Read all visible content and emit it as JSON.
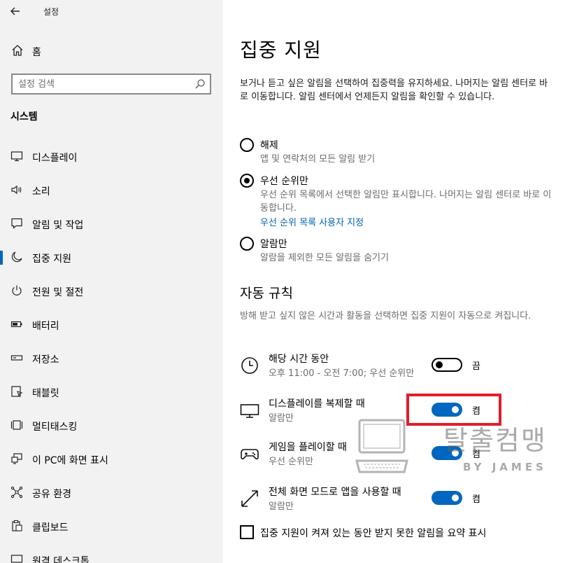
{
  "app": {
    "title": "설정"
  },
  "sidebar": {
    "home": "홈",
    "search_placeholder": "설정 검색",
    "section": "시스템",
    "items": [
      {
        "label": "디스플레이",
        "icon": "display-icon"
      },
      {
        "label": "소리",
        "icon": "speaker-icon"
      },
      {
        "label": "알림 및 작업",
        "icon": "notification-icon"
      },
      {
        "label": "집중 지원",
        "icon": "moon-icon",
        "active": true
      },
      {
        "label": "전원 및 절전",
        "icon": "power-icon"
      },
      {
        "label": "배터리",
        "icon": "battery-icon"
      },
      {
        "label": "저장소",
        "icon": "storage-icon"
      },
      {
        "label": "태블릿",
        "icon": "tablet-icon"
      },
      {
        "label": "멀티태스킹",
        "icon": "multitasking-icon"
      },
      {
        "label": "이 PC에 화면 표시",
        "icon": "project-icon"
      },
      {
        "label": "공유 환경",
        "icon": "share-icon"
      },
      {
        "label": "클립보드",
        "icon": "clipboard-icon"
      },
      {
        "label": "원격 데스크톱",
        "icon": "remote-desktop-icon"
      }
    ]
  },
  "main": {
    "title": "집중 지원",
    "description": "보거나 듣고 싶은 알림을 선택하여 집중력을 유지하세요. 나머지는 알림 센터로 바로 이동합니다. 알림 센터에서 언제든지 알림을 확인할 수 있습니다.",
    "options": [
      {
        "label": "해제",
        "description": "앱 및 연락처의 모든 알림 받기",
        "selected": false
      },
      {
        "label": "우선 순위만",
        "description": "우선 순위 목록에서 선택한 알림만 표시합니다. 나머지는 알림 센터로 바로 이동합니다.",
        "link": "우선 순위 목록 사용자 지정",
        "selected": true
      },
      {
        "label": "알람만",
        "description": "알람을 제외한 모든 알림을 숨기기",
        "selected": false
      }
    ],
    "auto_rules": {
      "heading": "자동 규칙",
      "description": "방해 받고 싶지 않은 시간과 활동을 선택하면 집중 지원이 자동으로 켜집니다.",
      "rules": [
        {
          "title": "해당 시간 동안",
          "subtitle": "오후 11:00 - 오전 7:00; 우선 순위만",
          "state": "끔",
          "on": false,
          "icon": "clock-icon"
        },
        {
          "title": "디스플레이를 복제할 때",
          "subtitle": "알람만",
          "state": "켬",
          "on": true,
          "icon": "monitor-icon"
        },
        {
          "title": "게임을 플레이할 때",
          "subtitle": "우선 순위만",
          "state": "켬",
          "on": true,
          "icon": "gamepad-icon"
        },
        {
          "title": "전체 화면 모드로 앱을 사용할 때",
          "subtitle": "알람만",
          "state": "켬",
          "on": true,
          "icon": "fullscreen-icon"
        }
      ]
    },
    "checkbox_label": "집중 지원이 켜져 있는 동안 받지 못한 알림을 요약 표시"
  },
  "watermark": {
    "title": "탈출컴맹",
    "subtitle": "BY JAMES"
  },
  "colors": {
    "accent": "#0067c0",
    "link": "#0063b1",
    "highlight": "#e01e2b",
    "sidebar_bg": "#f2f2f2"
  }
}
